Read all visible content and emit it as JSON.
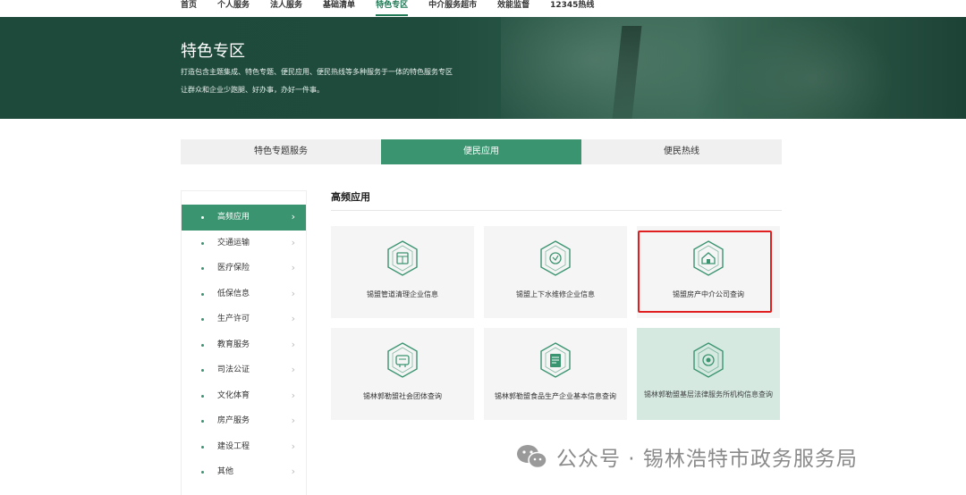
{
  "nav": {
    "items": [
      "首页",
      "个人服务",
      "法人服务",
      "基础清单",
      "特色专区",
      "中介服务超市",
      "效能监督",
      "12345热线"
    ],
    "active_index": 4
  },
  "banner": {
    "title": "特色专区",
    "desc_line1": "打造包含主题集成、特色专题、便民应用、便民热线等多种服务于一体的特色服务专区",
    "desc_line2": "让群众和企业少跑腿、好办事，办好一件事。"
  },
  "tabs": [
    {
      "label": "特色专题服务",
      "active": false
    },
    {
      "label": "便民应用",
      "active": true
    },
    {
      "label": "便民热线",
      "active": false
    }
  ],
  "sidebar": {
    "items": [
      {
        "label": "高频应用",
        "active": true
      },
      {
        "label": "交通运输",
        "active": false
      },
      {
        "label": "医疗保险",
        "active": false
      },
      {
        "label": "低保信息",
        "active": false
      },
      {
        "label": "生产许可",
        "active": false
      },
      {
        "label": "教育服务",
        "active": false
      },
      {
        "label": "司法公证",
        "active": false
      },
      {
        "label": "文化体育",
        "active": false
      },
      {
        "label": "房产服务",
        "active": false
      },
      {
        "label": "建设工程",
        "active": false
      },
      {
        "label": "其他",
        "active": false
      }
    ],
    "chevron_icon": "chevron-right-icon"
  },
  "content": {
    "section_title": "高频应用",
    "cards": [
      {
        "label": "锡盟管道清理企业信息",
        "icon": "pipe-cleaning-icon",
        "highlighted": false
      },
      {
        "label": "锡盟上下水维修企业信息",
        "icon": "plumbing-repair-icon",
        "highlighted": false
      },
      {
        "label": "锡盟房产中介公司查询",
        "icon": "real-estate-agency-icon",
        "highlighted": false
      },
      {
        "label": "锡林郭勒盟社会团体查询",
        "icon": "social-organization-icon",
        "highlighted": false
      },
      {
        "label": "锡林郭勒盟食品生产企业基本信息查询",
        "icon": "food-production-icon",
        "highlighted": false
      },
      {
        "label": "锡林郭勒盟基层法律服务所机构信息查询",
        "icon": "legal-service-icon",
        "highlighted": true
      }
    ]
  },
  "watermark": {
    "text": "公众号 · 锡林浩特市政务服务局",
    "icon": "wechat-logo-icon"
  },
  "colors": {
    "brand_green": "#3a9470",
    "banner_dark": "#1f4b3d",
    "highlight_red": "#e02020",
    "card_bg": "#f5f5f5",
    "card_highlight_bg": "#d5e9e1"
  }
}
